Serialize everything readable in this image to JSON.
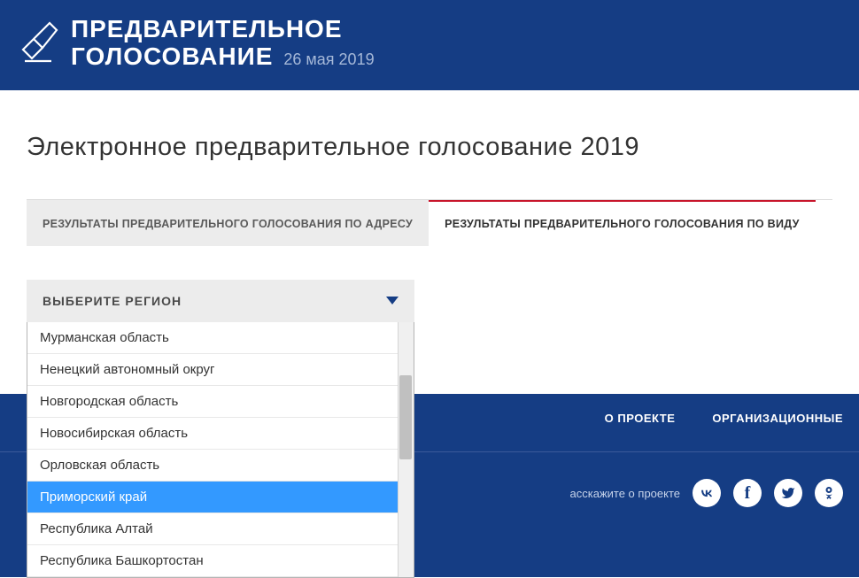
{
  "header": {
    "title_line1": "ПРЕДВАРИТЕЛЬНОЕ",
    "title_line2": "ГОЛОСОВАНИЕ",
    "date": "26 мая 2019"
  },
  "page_title": "Электронное предварительное голосование 2019",
  "tabs": [
    {
      "label": "РЕЗУЛЬТАТЫ ПРЕДВАРИТЕЛЬНОГО ГОЛОСОВАНИЯ ПО АДРЕСУ",
      "active": false
    },
    {
      "label": "РЕЗУЛЬТАТЫ ПРЕДВАРИТЕЛЬНОГО ГОЛОСОВАНИЯ ПО ВИДУ",
      "active": true
    }
  ],
  "selector": {
    "label": "ВЫБЕРИТЕ РЕГИОН",
    "options": [
      {
        "label": "Мурманская область",
        "selected": false
      },
      {
        "label": "Ненецкий автономный округ",
        "selected": false
      },
      {
        "label": "Новгородская область",
        "selected": false
      },
      {
        "label": "Новосибирская область",
        "selected": false
      },
      {
        "label": "Орловская область",
        "selected": false
      },
      {
        "label": "Приморский край",
        "selected": true
      },
      {
        "label": "Республика Алтай",
        "selected": false
      },
      {
        "label": "Республика Башкортостан",
        "selected": false
      }
    ]
  },
  "footer": {
    "nav": [
      {
        "label": "О ПРОЕКТЕ"
      },
      {
        "label": "ОРГАНИЗАЦИОННЫЕ "
      }
    ],
    "share_label": "асскажите о проекте",
    "social": [
      {
        "name": "vk",
        "glyph": "W"
      },
      {
        "name": "facebook",
        "glyph": "f"
      },
      {
        "name": "twitter",
        "glyph": ""
      },
      {
        "name": "odnoklassniki",
        "glyph": ""
      }
    ]
  }
}
